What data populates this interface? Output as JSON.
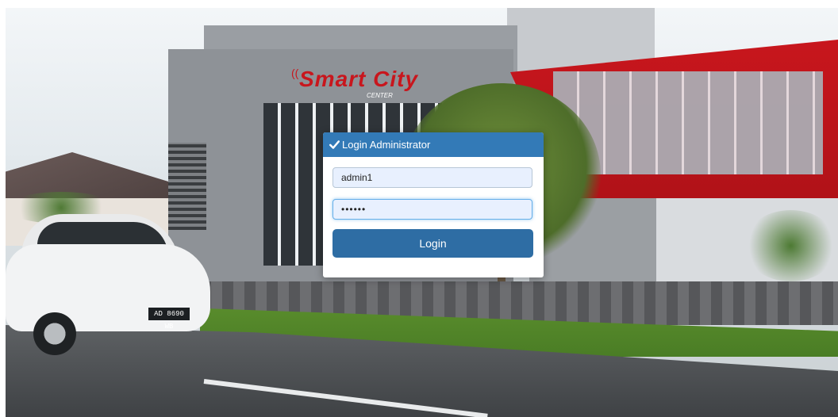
{
  "background": {
    "sign_title": "Smart City",
    "sign_subtitle": "CENTER",
    "plate_text": "AD 8690 WB"
  },
  "login": {
    "header_title": "Login Administrator",
    "header_icon": "check-icon",
    "username_value": "admin1",
    "password_value": "••••••",
    "button_label": "Login"
  },
  "colors": {
    "header": "#337ab7",
    "button": "#2e6da4",
    "input_bg": "#e8f0fe"
  }
}
